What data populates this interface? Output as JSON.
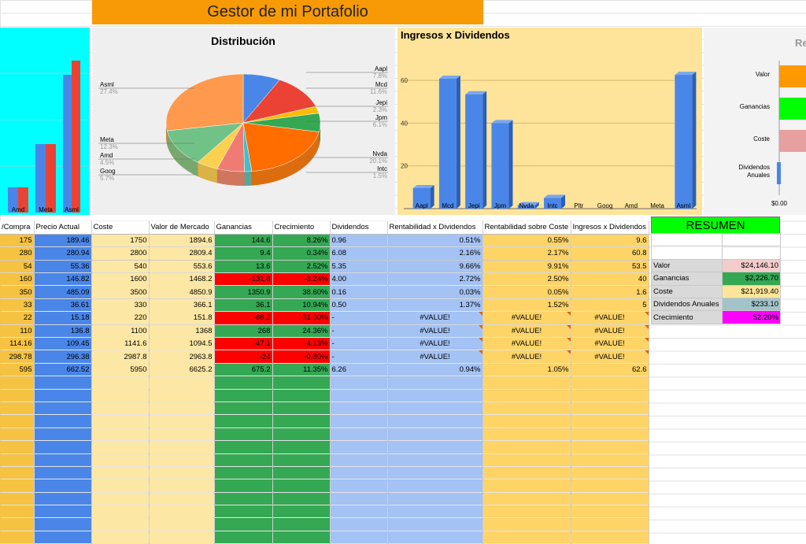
{
  "sheet_title": "Gestor de mi Portafolio",
  "colors": {
    "orange": "#f79a05",
    "cyan": "#00ffff",
    "yellow_panel": "#fde49a",
    "green": "#34a853",
    "blue": "#4a86e8",
    "red": "#ff0000",
    "resumen_green": "#00ff00",
    "magenta": "#ff00ff"
  },
  "left_chart": {
    "labels": [
      "Amd",
      "Meta",
      "Asml"
    ]
  },
  "distribution_chart": {
    "title": "Distribución",
    "slices": [
      {
        "name": "Aapl",
        "pct": "7.8%",
        "value": 7.8,
        "color": "#4a86e8"
      },
      {
        "name": "Mcd",
        "pct": "11.6%",
        "value": 11.6,
        "color": "#ea4335"
      },
      {
        "name": "Jepi",
        "pct": "2.3%",
        "value": 2.3,
        "color": "#fbbc04"
      },
      {
        "name": "Jpm",
        "pct": "6.1%",
        "value": 6.1,
        "color": "#34a853"
      },
      {
        "name": "Nvda",
        "pct": "20.1%",
        "value": 20.1,
        "color": "#ff6d01"
      },
      {
        "name": "Intc",
        "pct": "1.5%",
        "value": 1.5,
        "color": "#46bdc6"
      },
      {
        "name": "Goog",
        "pct": "5.7%",
        "value": 5.7,
        "color": "#f07b72"
      },
      {
        "name": "Amd",
        "pct": "4.5%",
        "value": 4.5,
        "color": "#fcd04f"
      },
      {
        "name": "Meta",
        "pct": "12.3%",
        "value": 12.3,
        "color": "#71c287"
      },
      {
        "name": "Asml",
        "pct": "27.4%",
        "value": 27.4,
        "color": "#ff994d"
      }
    ]
  },
  "chart_data": [
    {
      "type": "bar",
      "title": "Ingresos x Dividendos",
      "categories": [
        "Aapl",
        "Mcd",
        "Jepi",
        "Jpm",
        "Nvda",
        "Intc",
        "Pltr",
        "Goog",
        "Amd",
        "Meta",
        "Asml"
      ],
      "values": [
        9.6,
        60.8,
        53.5,
        40,
        1.6,
        5,
        0,
        0,
        0,
        0,
        62.6
      ],
      "ylim": [
        0,
        70
      ],
      "yticks": [
        "20",
        "40",
        "60"
      ]
    },
    {
      "type": "bar",
      "title": "Re",
      "categories": [
        "Valor",
        "Ganancias",
        "Coste",
        "Dividendos Anuales"
      ],
      "axis_label": "$0.00"
    }
  ],
  "headers": [
    "/Compra",
    "Precio Actual",
    "Coste",
    "Valor de Mercado",
    "Ganancias",
    "Crecimiento",
    "Dividendos",
    "Rentabilidad x Dividendos",
    "Rentabilidad sobre Coste",
    "Ingresos x Dividendos"
  ],
  "rows": [
    [
      "175",
      "189.46",
      "1750",
      "1894.6",
      "144.6",
      "8.26%",
      "0.96",
      "0.51%",
      "0.55%",
      "9.6"
    ],
    [
      "280",
      "280.94",
      "2800",
      "2809.4",
      "9.4",
      "0.34%",
      "6.08",
      "2.16%",
      "2.17%",
      "60.8"
    ],
    [
      "54",
      "55.36",
      "540",
      "553.6",
      "13.6",
      "2.52%",
      "5.35",
      "9.66%",
      "9.91%",
      "53.5"
    ],
    [
      "160",
      "146.82",
      "1600",
      "1468.2",
      "-131.8",
      "-8.24%",
      "4.00",
      "2.72%",
      "2.50%",
      "40"
    ],
    [
      "350",
      "485.09",
      "3500",
      "4850.9",
      "1350.9",
      "38.60%",
      "0.16",
      "0.03%",
      "0.05%",
      "1.6"
    ],
    [
      "33",
      "36.61",
      "330",
      "366.1",
      "36.1",
      "10.94%",
      "0.50",
      "1.37%",
      "1.52%",
      "5"
    ],
    [
      "22",
      "15.18",
      "220",
      "151.8",
      "-68.2",
      "-31.00%",
      "-",
      "#VALUE!",
      "#VALUE!",
      "#VALUE!"
    ],
    [
      "110",
      "136.8",
      "1100",
      "1368",
      "268",
      "24.36%",
      "-",
      "#VALUE!",
      "#VALUE!",
      "#VALUE!"
    ],
    [
      "114.16",
      "109.45",
      "1141.6",
      "1094.5",
      "-47.1",
      "-4.13%",
      "-",
      "#VALUE!",
      "#VALUE!",
      "#VALUE!"
    ],
    [
      "298.78",
      "296.38",
      "2987.8",
      "2963.8",
      "-24",
      "-0.80%",
      "-",
      "#VALUE!",
      "#VALUE!",
      "#VALUE!"
    ],
    [
      "595",
      "662.52",
      "5950",
      "6625.2",
      "675.2",
      "11.35%",
      "6.26",
      "0.94%",
      "1.05%",
      "62.6"
    ]
  ],
  "resumen": {
    "title": "RESUMEN",
    "items": [
      {
        "label": "Valor",
        "value": "$24,146.10",
        "bg": "#f4cccc"
      },
      {
        "label": "Ganancias",
        "value": "$2,226.70",
        "bg": "#34a853"
      },
      {
        "label": "Coste",
        "value": "$21,919.40",
        "bg": "#ffe599"
      },
      {
        "label": "Dividendos Anuales",
        "value": "$233.10",
        "bg": "#a2c4c9"
      },
      {
        "label": "Crecimiento",
        "value": "52.20%",
        "bg": "#ff00ff"
      }
    ]
  }
}
